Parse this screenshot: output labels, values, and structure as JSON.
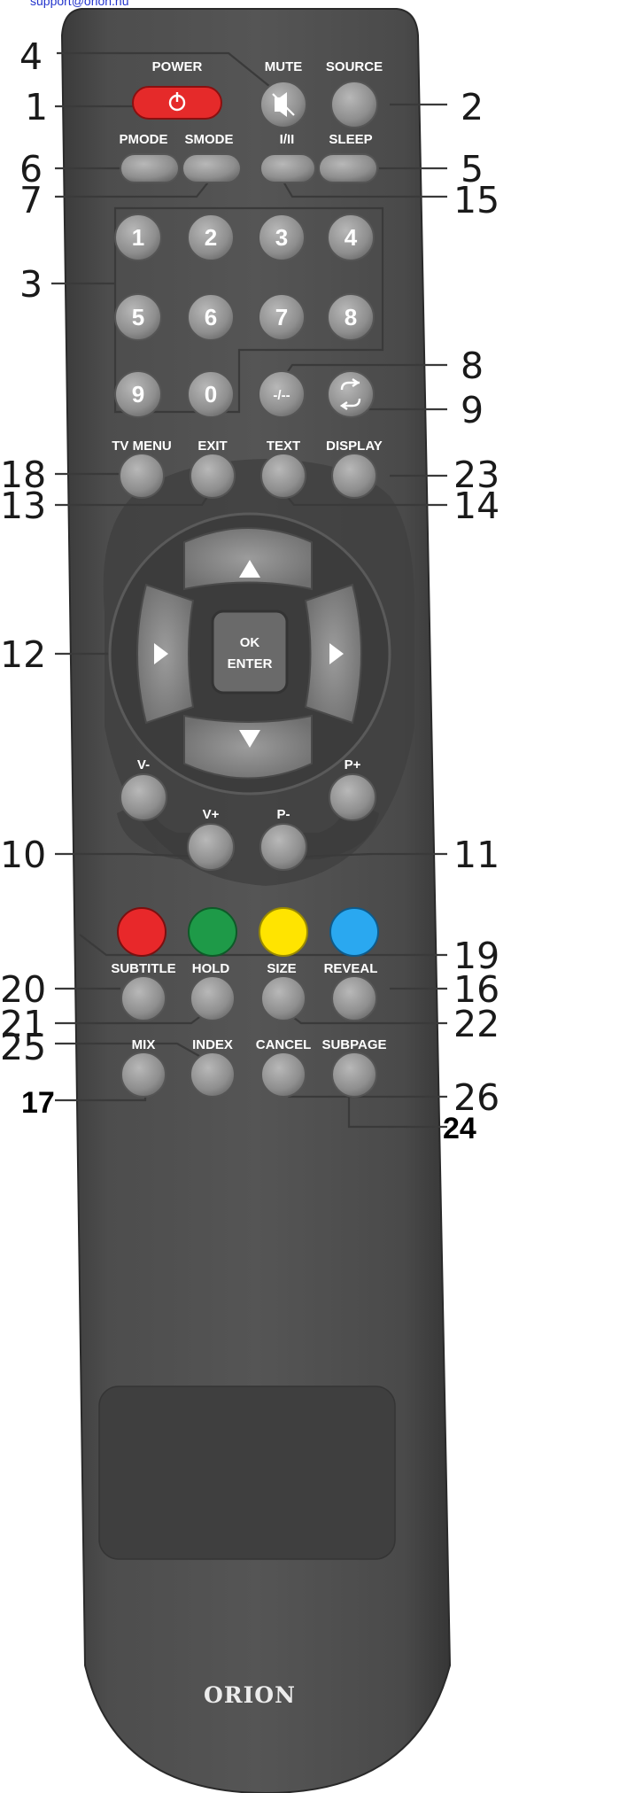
{
  "header": {
    "email": "support@orion.hu"
  },
  "brand": "ORION",
  "buttons": {
    "power": "POWER",
    "mute": "MUTE",
    "source": "SOURCE",
    "pmode": "PMODE",
    "smode": "SMODE",
    "dual": "I/II",
    "sleep": "SLEEP",
    "digits": [
      "1",
      "2",
      "3",
      "4",
      "5",
      "6",
      "7",
      "8",
      "9",
      "0"
    ],
    "dash": "-/--",
    "tv_menu": "TV MENU",
    "exit": "EXIT",
    "text": "TEXT",
    "display": "DISPLAY",
    "ok_top": "OK",
    "ok_bottom": "ENTER",
    "v_minus": "V-",
    "v_plus": "V+",
    "p_minus": "P-",
    "p_plus": "P+",
    "subtitle": "SUBTITLE",
    "hold": "HOLD",
    "size": "SIZE",
    "reveal": "REVEAL",
    "mix": "MIX",
    "index": "INDEX",
    "cancel": "CANCEL",
    "subpage": "SUBPAGE"
  },
  "colors": {
    "power": "#e52a2a",
    "red": "#e8282a",
    "green": "#1e9a48",
    "yellow": "#ffe400",
    "blue": "#2aa8f0"
  },
  "callouts": {
    "c1": "1",
    "c2": "2",
    "c3": "3",
    "c4": "4",
    "c5": "5",
    "c6": "6",
    "c7": "7",
    "c8": "8",
    "c9": "9",
    "c10": "10",
    "c11": "11",
    "c12": "12",
    "c13": "13",
    "c14": "14",
    "c15": "15",
    "c16": "16",
    "c17": "17",
    "c18": "18",
    "c19": "19",
    "c20": "20",
    "c21": "21",
    "c22": "22",
    "c23": "23",
    "c24": "24",
    "c25": "25",
    "c26": "26"
  }
}
